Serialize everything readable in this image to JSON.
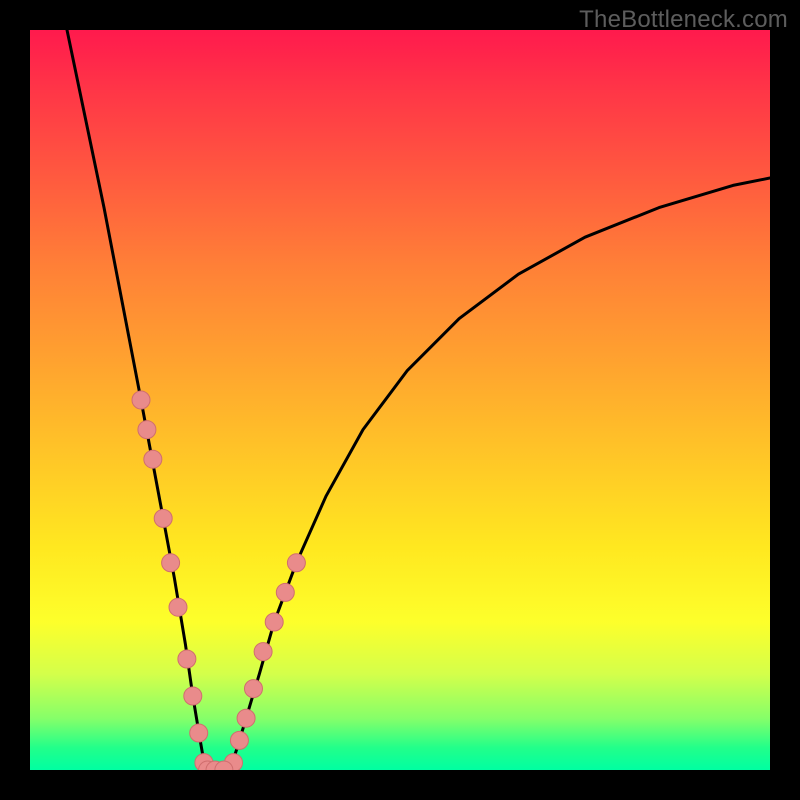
{
  "attribution": "TheBottleneck.com",
  "chart_data": {
    "type": "line",
    "title": "",
    "xlabel": "",
    "ylabel": "",
    "xlim": [
      0,
      100
    ],
    "ylim": [
      0,
      100
    ],
    "curve_left": {
      "description": "steep descending branch",
      "x": [
        5,
        7.5,
        10,
        12.5,
        15,
        16.5,
        18,
        19.5,
        21,
        22,
        23,
        23.7
      ],
      "y": [
        100,
        88,
        76,
        63,
        50,
        42,
        34,
        26,
        17,
        10,
        4,
        0
      ]
    },
    "curve_right": {
      "description": "rising branch, decelerating",
      "x": [
        27,
        28,
        29.5,
        31,
        33,
        36,
        40,
        45,
        51,
        58,
        66,
        75,
        85,
        95,
        100
      ],
      "y": [
        0,
        3,
        8,
        13,
        20,
        28,
        37,
        46,
        54,
        61,
        67,
        72,
        76,
        79,
        80
      ]
    },
    "trough": {
      "x": [
        23.7,
        27
      ],
      "y": [
        0,
        0
      ]
    },
    "markers_left": {
      "x": [
        15.0,
        15.8,
        16.6,
        18.0,
        19.0,
        20.0,
        21.2,
        22.0,
        22.8,
        23.5
      ],
      "y": [
        50,
        46,
        42,
        34,
        28,
        22,
        15,
        10,
        5,
        1
      ]
    },
    "markers_right": {
      "x": [
        27.5,
        28.3,
        29.2,
        30.2,
        31.5,
        33.0,
        34.5,
        36.0
      ],
      "y": [
        1,
        4,
        7,
        11,
        16,
        20,
        24,
        28
      ]
    },
    "markers_bottom": {
      "x": [
        24.0,
        25.0,
        26.2
      ],
      "y": [
        0,
        0,
        0
      ]
    },
    "colors": {
      "curve": "#000000",
      "marker_fill": "#e98b8b",
      "marker_stroke": "#d06e6e"
    }
  }
}
